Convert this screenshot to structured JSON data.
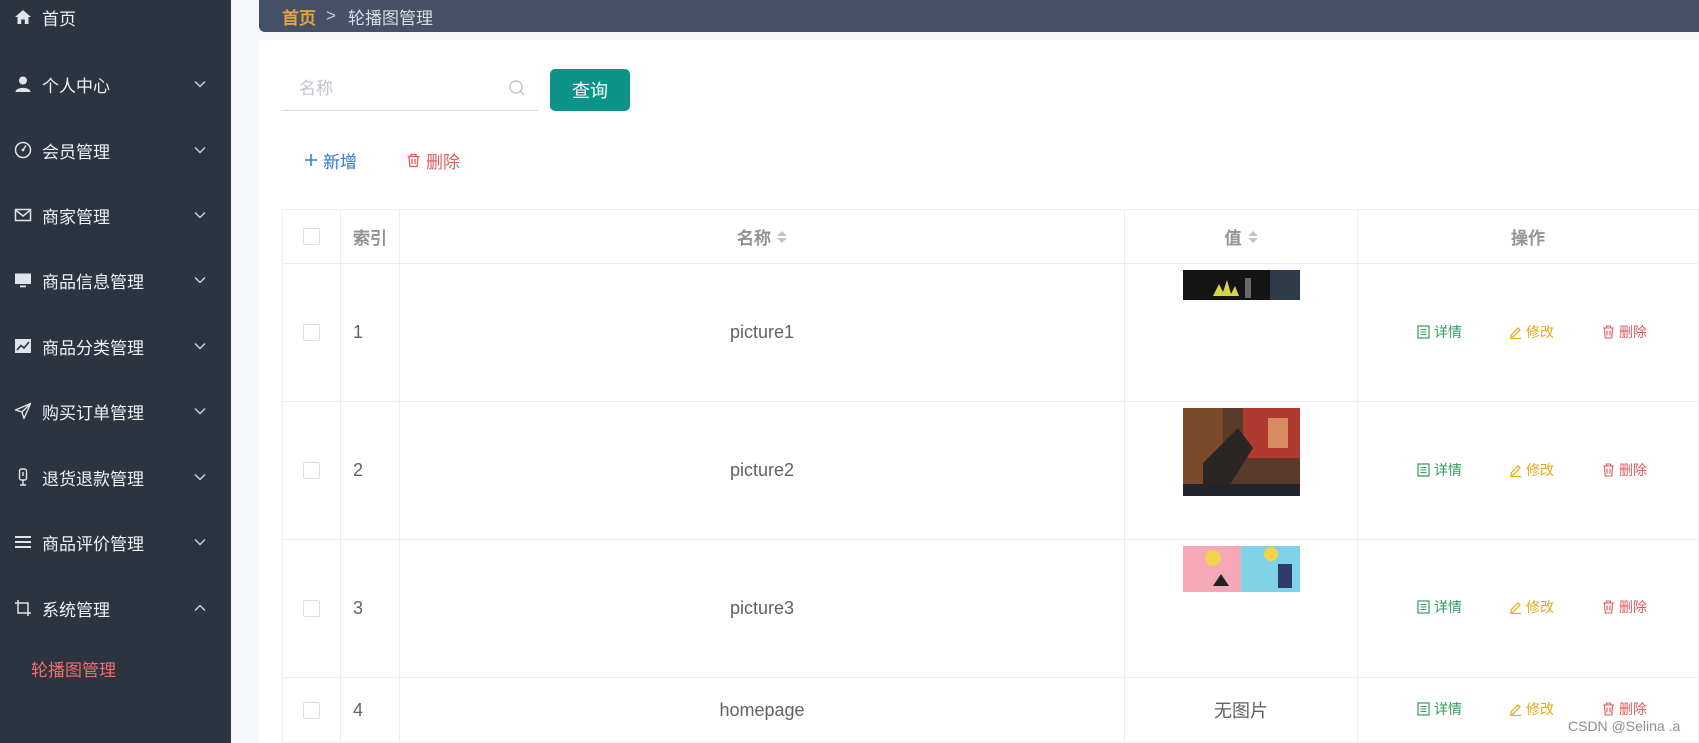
{
  "sidebar": {
    "items": [
      {
        "label": "首页",
        "icon": "home-icon"
      },
      {
        "label": "个人中心",
        "icon": "user-icon"
      },
      {
        "label": "会员管理",
        "icon": "dashboard-icon"
      },
      {
        "label": "商家管理",
        "icon": "mail-icon"
      },
      {
        "label": "商品信息管理",
        "icon": "monitor-icon"
      },
      {
        "label": "商品分类管理",
        "icon": "chart-icon"
      },
      {
        "label": "购买订单管理",
        "icon": "send-icon"
      },
      {
        "label": "退货退款管理",
        "icon": "microphone-icon"
      },
      {
        "label": "商品评价管理",
        "icon": "list-icon"
      },
      {
        "label": "系统管理",
        "icon": "crop-icon"
      }
    ],
    "submenu": {
      "label": "轮播图管理",
      "active_color": "#f56c6c"
    }
  },
  "breadcrumb": {
    "home": "首页",
    "separator": ">",
    "current": "轮播图管理",
    "home_color": "#e6a23c"
  },
  "search": {
    "placeholder": "名称",
    "query_label": "查询"
  },
  "toolbar": {
    "add_label": "新增",
    "delete_label": "删除"
  },
  "table": {
    "headers": {
      "index": "索引",
      "name": "名称",
      "value": "值",
      "actions": "操作"
    },
    "rows": [
      {
        "index": "1",
        "name": "picture1",
        "value": ""
      },
      {
        "index": "2",
        "name": "picture2",
        "value": ""
      },
      {
        "index": "3",
        "name": "picture3",
        "value": ""
      },
      {
        "index": "4",
        "name": "homepage",
        "value": "无图片"
      }
    ],
    "actions": {
      "detail": "详情",
      "edit": "修改",
      "delete": "删除"
    }
  },
  "watermark": "CSDN @Selina .a",
  "colors": {
    "sidebar_bg": "#2c3440",
    "topbar_bg": "#445166",
    "primary": "#0d9488",
    "detail": "#2e9e5b",
    "edit": "#e6a817",
    "danger": "#e25a5a",
    "link": "#2b79d6"
  }
}
